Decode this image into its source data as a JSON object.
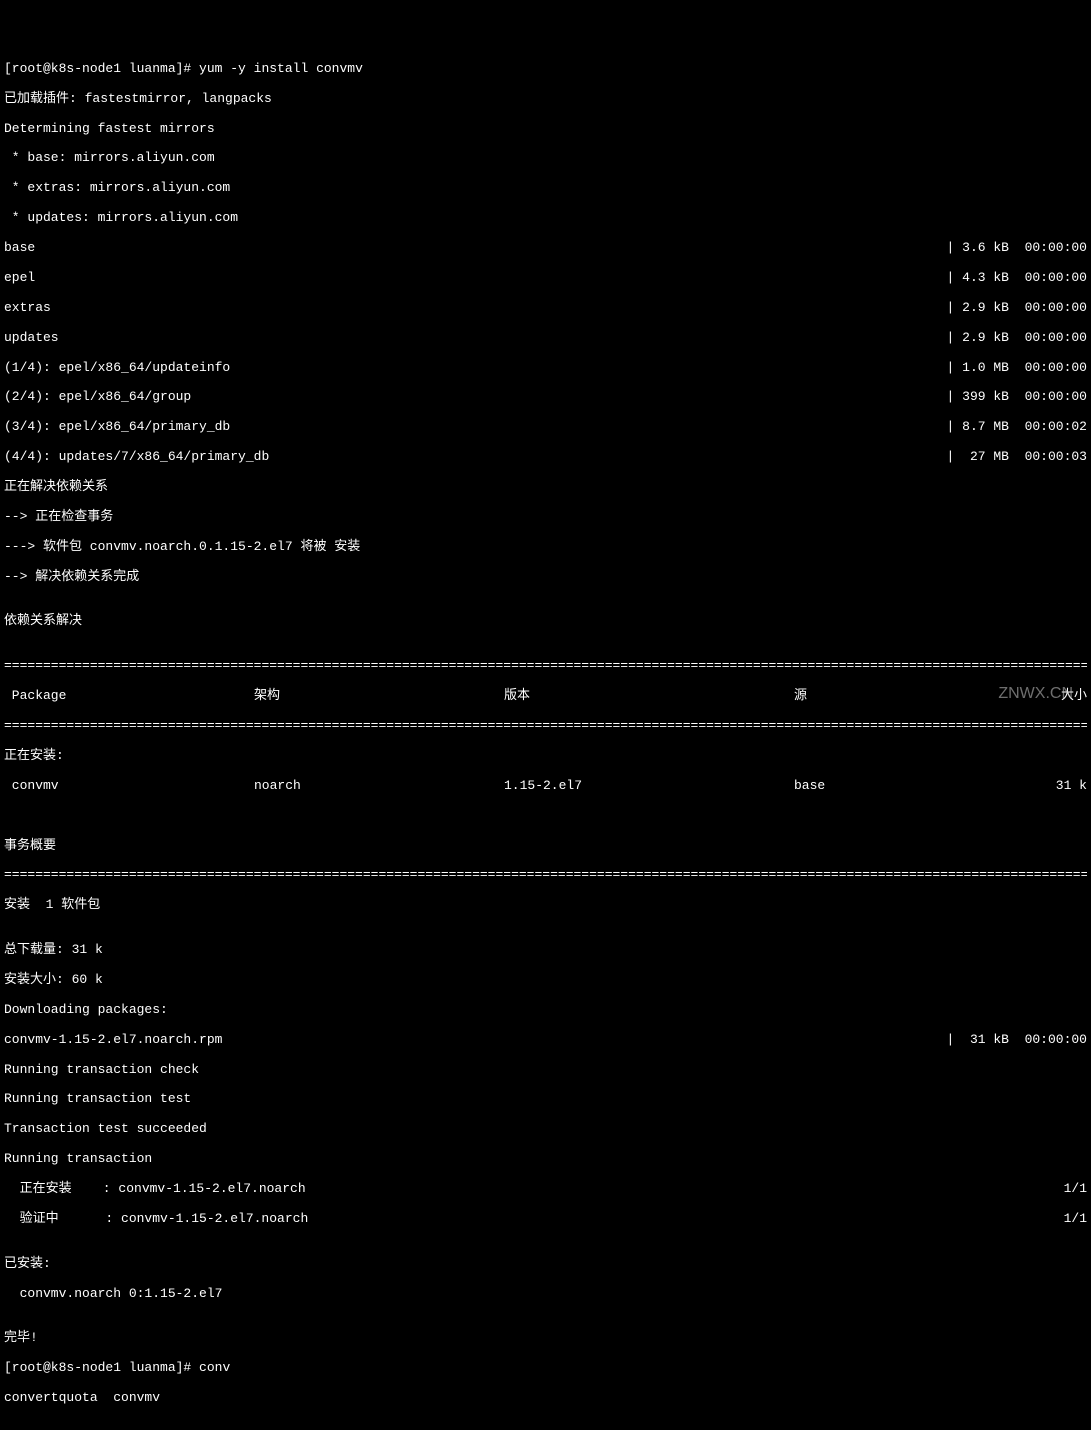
{
  "prompt1": "[root@k8s-node1 luanma]# ",
  "cmd1": "yum -y install convmv",
  "preLines": [
    "已加载插件: fastestmirror, langpacks",
    "Determining fastest mirrors",
    " * base: mirrors.aliyun.com",
    " * extras: mirrors.aliyun.com",
    " * updates: mirrors.aliyun.com"
  ],
  "repoLines": [
    {
      "name": "base",
      "size": "3.6 kB",
      "time": "00:00:00"
    },
    {
      "name": "epel",
      "size": "4.3 kB",
      "time": "00:00:00"
    },
    {
      "name": "extras",
      "size": "2.9 kB",
      "time": "00:00:00"
    },
    {
      "name": "updates",
      "size": "2.9 kB",
      "time": "00:00:00"
    }
  ],
  "dlLines": [
    {
      "name": "(1/4): epel/x86_64/updateinfo",
      "size": "1.0 MB",
      "time": "00:00:00"
    },
    {
      "name": "(2/4): epel/x86_64/group",
      "size": " 399 kB",
      "time": "00:00:00"
    },
    {
      "name": "(3/4): epel/x86_64/primary_db",
      "size": "8.7 MB",
      "time": "00:00:02"
    },
    {
      "name": "(4/4): updates/7/x86_64/primary_db",
      "size": "  27 MB",
      "time": "00:00:03"
    }
  ],
  "depLines": [
    "正在解决依赖关系",
    "--> 正在检查事务",
    "---> 软件包 convmv.noarch.0.1.15-2.el7 将被 安装",
    "--> 解决依赖关系完成",
    "",
    "依赖关系解决",
    ""
  ],
  "sep": "===========================================================================================================================================================================",
  "tableHeader": {
    "package": " Package",
    "arch": "架构",
    "version": "版本",
    "repo": "源",
    "size": "大小"
  },
  "installingLabel": "正在安装:",
  "row": {
    "package": " convmv",
    "arch": "noarch",
    "version": "1.15-2.el7",
    "repo": "base",
    "size": "31 k"
  },
  "summaryLabel": "事务概要",
  "installCount": "安装  1 软件包",
  "postLines": [
    "",
    "总下载量: 31 k",
    "安装大小: 60 k",
    "Downloading packages:"
  ],
  "pkgDl": {
    "name": "convmv-1.15-2.el7.noarch.rpm",
    "size": "  31 kB",
    "time": "00:00:00"
  },
  "transLines": [
    "Running transaction check",
    "Running transaction test",
    "Transaction test succeeded",
    "Running transaction"
  ],
  "installRow": {
    "left": "  正在安装    : convmv-1.15-2.el7.noarch",
    "right": "1/1"
  },
  "verifyRow": {
    "left": "  验证中      : convmv-1.15-2.el7.noarch",
    "right": "1/1"
  },
  "installedLines": [
    "",
    "已安装:",
    "  convmv.noarch 0:1.15-2.el7",
    "",
    "完毕!"
  ],
  "prompt2": "[root@k8s-node1 luanma]# ",
  "cmd2": "conv",
  "completion": "convertquota  convmv",
  "watermark": "ZNWX.CN"
}
